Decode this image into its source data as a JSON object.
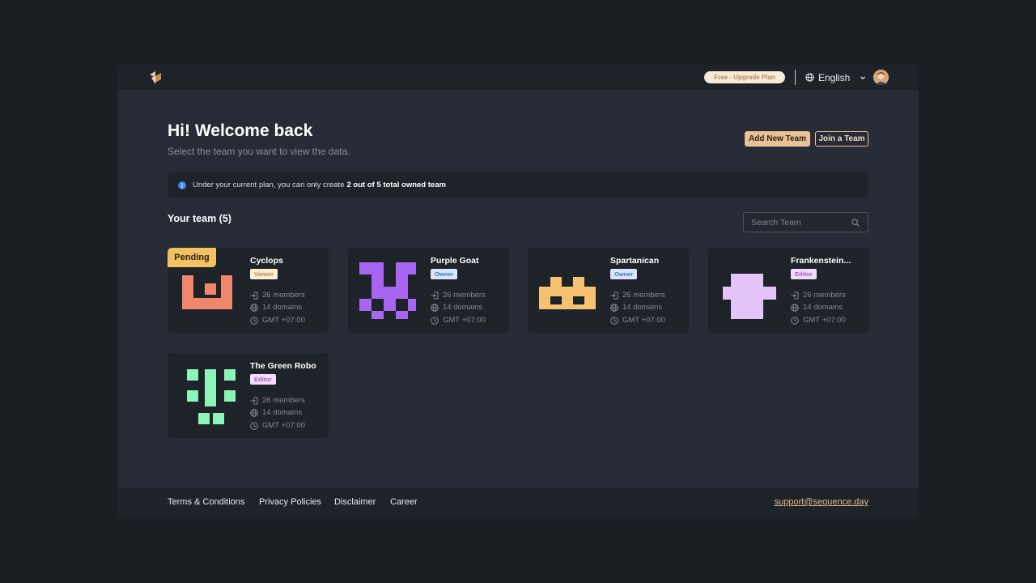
{
  "topbar": {
    "logo_icon": "sequence-logo-icon",
    "upgrade_label": "Free - Upgrade Plan",
    "language": "English",
    "avatar_icon": "user-avatar"
  },
  "header": {
    "title": "Hi! Welcome back",
    "subtitle": "Select the team you want to view the data.",
    "add_team_label": "Add New Team",
    "join_team_label": "Join a Team"
  },
  "notice": {
    "icon": "info-icon",
    "text": "Under your current plan, you can only create",
    "bold": "2 out of 5 total owned team"
  },
  "teams_section": {
    "title": "Your team (5)",
    "search_placeholder": "Search Team"
  },
  "teams": [
    {
      "name": "Cyclops",
      "role": "Viewer",
      "members": "26 members",
      "domains": "14 domains",
      "timezone": "GMT +07:00",
      "badge": "Pending",
      "art_color": "#f0876a"
    },
    {
      "name": "Purple Goat",
      "role": "Owner",
      "members": "26 members",
      "domains": "14 domains",
      "timezone": "GMT +07:00",
      "art_color": "#a865f2"
    },
    {
      "name": "Spartanican",
      "role": "Owner",
      "members": "26 members",
      "domains": "14 domains",
      "timezone": "GMT +07:00",
      "art_color": "#f6c171"
    },
    {
      "name": "Frankenstein...",
      "role": "Editor",
      "members": "26 members",
      "domains": "14 domains",
      "timezone": "GMT +07:00",
      "art_color": "#e3c5fa"
    },
    {
      "name": "The Green Robo",
      "role": "Editor",
      "members": "26 members",
      "domains": "14 domains",
      "timezone": "GMT +07:00",
      "art_color": "#8ef3b6"
    }
  ],
  "footer": {
    "links": [
      "Terms & Conditions",
      "Privacy Policies",
      "Disclaimer",
      "Career"
    ],
    "support_email": "support@sequence.day"
  }
}
